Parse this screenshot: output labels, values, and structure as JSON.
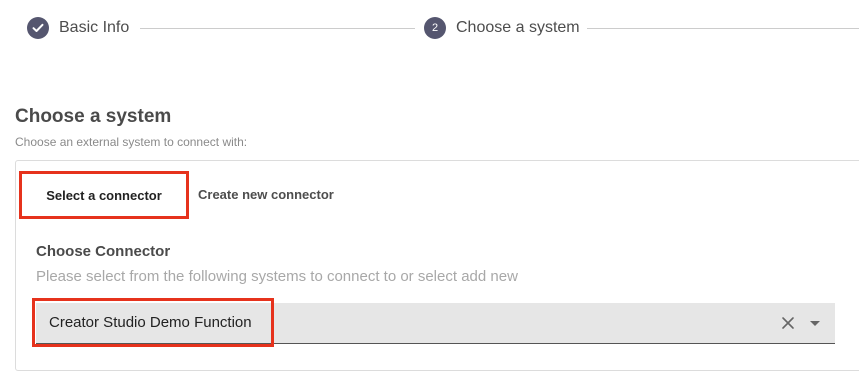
{
  "stepper": {
    "steps": [
      {
        "label": "Basic Info",
        "status": "complete",
        "icon": "check-icon"
      },
      {
        "label": "Choose a system",
        "status": "active",
        "number": "2"
      }
    ]
  },
  "section": {
    "title": "Choose a system",
    "subtitle": "Choose an external system to connect with:"
  },
  "tabs": {
    "select_connector": "Select a connector",
    "create_connector": "Create new connector"
  },
  "connector_field": {
    "label": "Choose Connector",
    "hint": "Please select from the following systems to connect to or select add new",
    "value": "Creator Studio Demo Function",
    "clear_icon": "close-icon",
    "dropdown_icon": "caret-down-icon"
  },
  "colors": {
    "step_circle": "#55566f",
    "highlight": "#e6321c",
    "select_bg": "#e6e6e6"
  }
}
